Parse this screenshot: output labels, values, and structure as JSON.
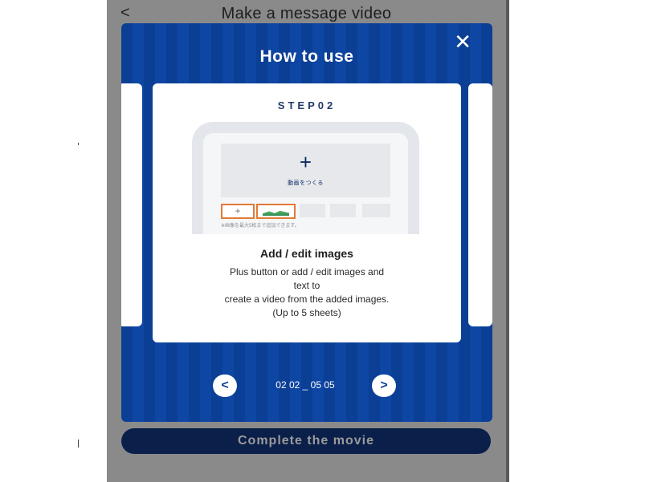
{
  "header": {
    "back_label": "<",
    "title": "Make a message video"
  },
  "modal": {
    "close_label": "✕",
    "title": "How to use",
    "card": {
      "step_label": "STEP02",
      "mockup_caption": "動画をつくる",
      "mockup_note": "※画像を最大5枚まで追加できます。",
      "heading": "Add / edit images",
      "description_lines": [
        "Plus button or add / edit images and",
        "text to",
        "create a video from the added images.",
        "(Up to 5 sheets)"
      ]
    },
    "pager": {
      "prev_label": "<",
      "next_label": ">",
      "text": "02 02 _ 05 05"
    }
  },
  "footer": {
    "complete_label": "Complete the movie"
  },
  "colors": {
    "modal_blue": "#0b3f95",
    "dark_navy": "#0a1f4a",
    "highlight_orange": "#e27a36",
    "overlay_gray": "#8a8a8a"
  },
  "icons": {
    "close": "close-icon",
    "back": "chevron-left-icon",
    "prev": "chevron-left-icon",
    "next": "chevron-right-icon",
    "add": "plus-icon",
    "image": "image-icon"
  }
}
